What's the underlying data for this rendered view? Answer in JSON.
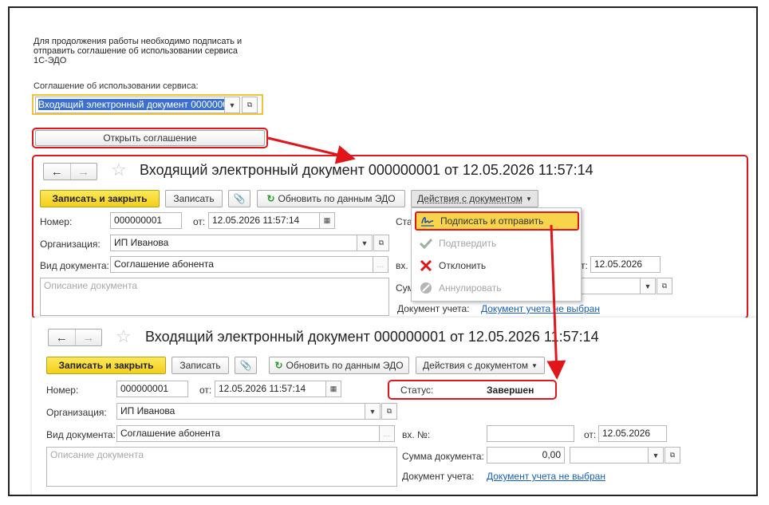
{
  "intro": {
    "lines": [
      "Для продолжения работы необходимо подписать и",
      "отправить соглашение об использовании сервиса",
      "1С-ЭДО"
    ],
    "agreement_label": "Соглашение об использовании сервиса:",
    "agreement_value": "Входящий электронный документ 0000000",
    "open_button": "Открыть соглашение"
  },
  "upper": {
    "title": "Входящий электронный документ 000000001 от 12.05.2026 11:57:14",
    "toolbar": {
      "save_close": "Записать и закрыть",
      "save": "Записать",
      "refresh": "Обновить по данным ЭДО",
      "actions": "Действия с документом"
    },
    "number_label": "Номер:",
    "number_value": "000000001",
    "date_label": "от:",
    "date_value": "12.05.2026 11:57:14",
    "org_label": "Организация:",
    "org_value": "ИП Иванова",
    "doctype_label": "Вид документа:",
    "doctype_value": "Соглашение абонента",
    "desc_placeholder": "Описание документа",
    "status_label_partial": "Ста",
    "in_no_label_partial": "вх.",
    "sum_label_partial": "Сум",
    "in_date_label_partial": "т:",
    "in_date_value": "12.05.2026",
    "account_doc_label": "Документ учета:",
    "account_doc_link": "Документ учета не выбран",
    "menu": [
      {
        "label": "Подписать и отправить",
        "icon": "signature-icon",
        "state": "highlighted"
      },
      {
        "label": "Подтвердить",
        "icon": "checkmark-icon",
        "state": "disabled"
      },
      {
        "label": "Отклонить",
        "icon": "cross-icon",
        "state": "enabled"
      },
      {
        "label": "Аннулировать",
        "icon": "cancel-circle-icon",
        "state": "disabled"
      }
    ]
  },
  "lower": {
    "title": "Входящий электронный документ 000000001 от 12.05.2026 11:57:14",
    "toolbar": {
      "save_close": "Записать и закрыть",
      "save": "Записать",
      "refresh": "Обновить по данным ЭДО",
      "actions": "Действия с документом"
    },
    "number_label": "Номер:",
    "number_value": "000000001",
    "date_label": "от:",
    "date_value": "12.05.2026 11:57:14",
    "status_label": "Статус:",
    "status_value": "Завершен",
    "org_label": "Организация:",
    "org_value": "ИП Иванова",
    "doctype_label": "Вид документа:",
    "doctype_value": "Соглашение абонента",
    "in_no_label": "вх. №:",
    "in_date_label": "от:",
    "in_date_value": "12.05.2026",
    "desc_placeholder": "Описание документа",
    "sum_label": "Сумма документа:",
    "sum_value": "0,00",
    "account_doc_label": "Документ учета:",
    "account_doc_link": "Документ учета не выбран"
  },
  "colors": {
    "highlight_red": "#e0161b",
    "primary_yellow": "#f3cf1b",
    "link_blue": "#1560bd"
  }
}
